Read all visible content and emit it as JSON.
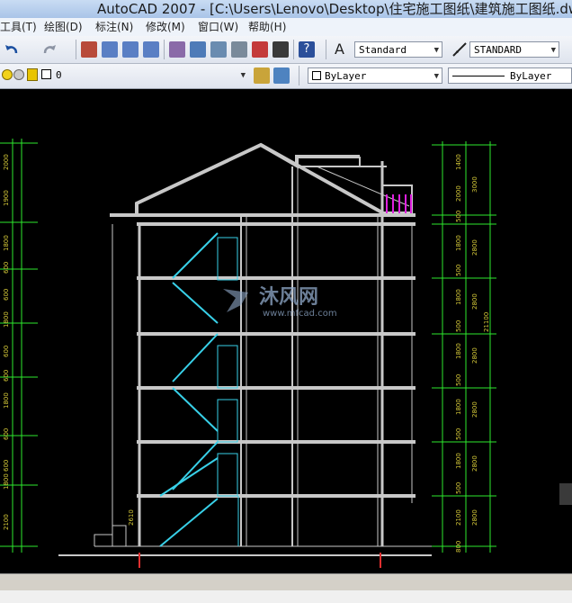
{
  "window": {
    "title": "AutoCAD 2007 - [C:\\Users\\Lenovo\\Desktop\\住宅施工图纸\\建筑施工图纸.dw"
  },
  "menu": [
    {
      "label": "工具(T)"
    },
    {
      "label": "绘图(D)"
    },
    {
      "label": "标注(N)"
    },
    {
      "label": "修改(M)"
    },
    {
      "label": "窗口(W)"
    },
    {
      "label": "帮助(H)"
    }
  ],
  "toolbar": {
    "text_style": "Standard",
    "dim_style": "STANDARD",
    "layer": "0",
    "color": "ByLayer",
    "linetype": "ByLayer"
  },
  "watermark": {
    "brand": "沐风网",
    "url": "www.mfcad.com"
  },
  "dimensions": {
    "left": [
      "2000",
      "1900",
      "1800",
      "600",
      "600",
      "1800",
      "600",
      "600",
      "1800",
      "600",
      "600",
      "1800",
      "600",
      "600",
      "1800",
      "600",
      "2100"
    ],
    "right_inner": [
      "1400",
      "2000",
      "500",
      "1800",
      "500",
      "1800",
      "500",
      "1800",
      "500",
      "1800",
      "500",
      "1800",
      "500",
      "2100",
      "800"
    ],
    "right_outer": [
      "3000",
      "2800",
      "2800",
      "2800",
      "2800",
      "2800",
      "2800",
      "2800"
    ],
    "total": "21100",
    "stair_label": "2610"
  }
}
